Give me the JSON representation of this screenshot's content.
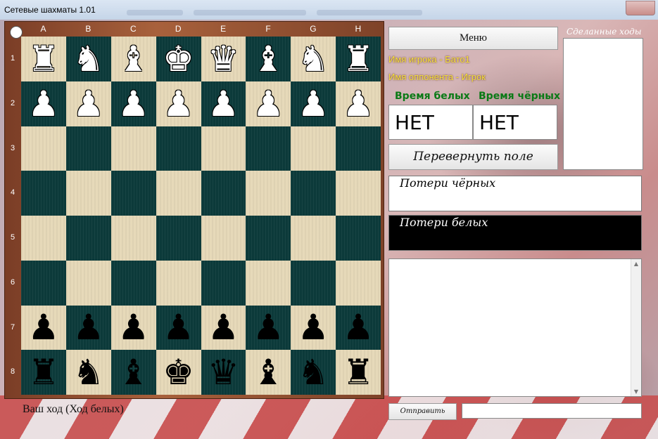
{
  "window": {
    "title": "Сетевые шахматы 1.01"
  },
  "board": {
    "files": [
      "A",
      "B",
      "C",
      "D",
      "E",
      "F",
      "G",
      "H"
    ],
    "ranks": [
      "1",
      "2",
      "3",
      "4",
      "5",
      "6",
      "7",
      "8"
    ],
    "rows": [
      [
        "wr",
        "wn",
        "wb",
        "wk",
        "wq",
        "wb",
        "wn",
        "wr"
      ],
      [
        "wp",
        "wp",
        "wp",
        "wp",
        "wp",
        "wp",
        "wp",
        "wp"
      ],
      [
        "",
        "",
        "",
        "",
        "",
        "",
        "",
        ""
      ],
      [
        "",
        "",
        "",
        "",
        "",
        "",
        "",
        ""
      ],
      [
        "",
        "",
        "",
        "",
        "",
        "",
        "",
        ""
      ],
      [
        "",
        "",
        "",
        "",
        "",
        "",
        "",
        ""
      ],
      [
        "bp",
        "bp",
        "bp",
        "bp",
        "bp",
        "bp",
        "bp",
        "bp"
      ],
      [
        "br",
        "bn",
        "bb",
        "bk",
        "bq",
        "bb",
        "bn",
        "br"
      ]
    ],
    "turn_indicator": "white",
    "colors": {
      "light": "#e6d9b9",
      "dark": "#0c3a3a",
      "frame": "#a8613c"
    }
  },
  "status": {
    "text": "Ваш ход (Ход белых)"
  },
  "panel": {
    "menu_label": "Меню",
    "player_name": "Имя игрока -  Бато1",
    "opponent_name": "Имя оппонента - Игрок",
    "white_time_label": "Время белых",
    "black_time_label": "Время чёрных",
    "white_time_value": "НЕТ",
    "black_time_value": "НЕТ",
    "flip_label": "Перевернуть поле",
    "black_losses_label": "Потери чёрных",
    "white_losses_label": "Потери белых",
    "moves_title": "Сделанные ходы",
    "send_label": "Отправить",
    "message_value": ""
  }
}
